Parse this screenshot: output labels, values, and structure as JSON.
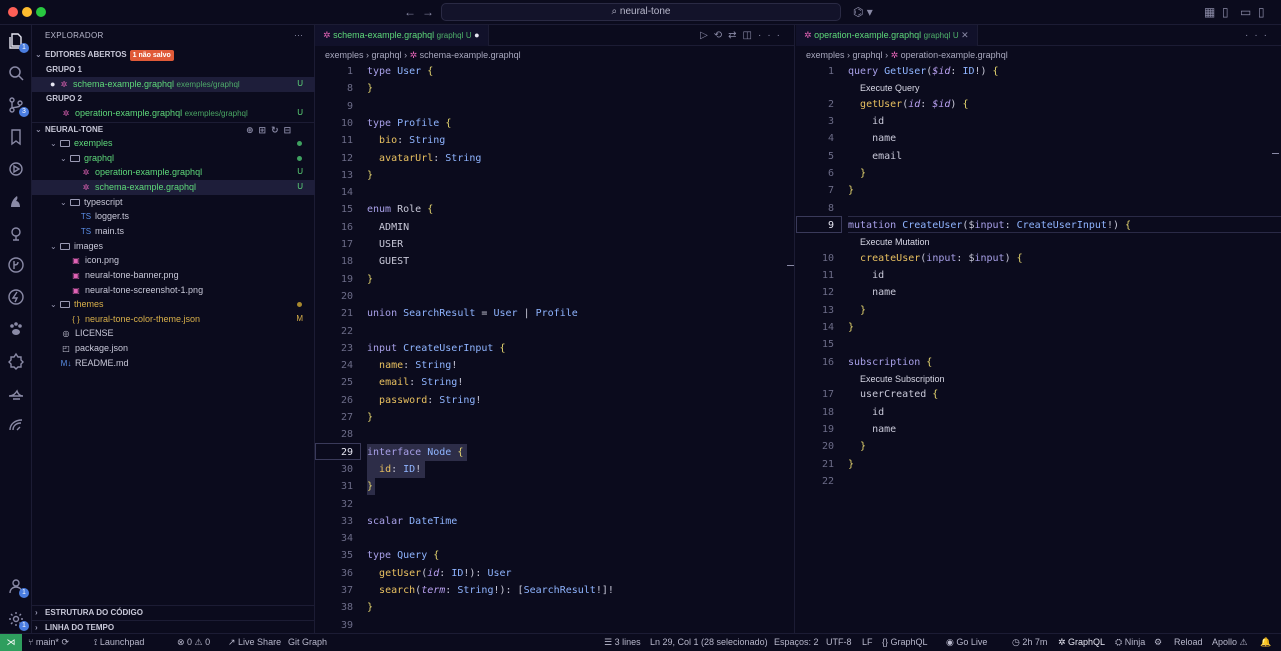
{
  "window": {
    "search_text": "neural-tone",
    "search_icon": "search-icon"
  },
  "explorer": {
    "title": "EXPLORADOR",
    "open_editors": {
      "label": "EDITORES ABERTOS",
      "badge": "1 não salvo"
    },
    "group1": {
      "label": "GRUPO 1",
      "file": "schema-example.graphql",
      "path": "exemples/graphql",
      "status": "U"
    },
    "group2": {
      "label": "GRUPO 2",
      "file": "operation-example.graphql",
      "path": "exemples/graphql",
      "status": "U"
    },
    "project": "NEURAL-TONE",
    "tree": [
      {
        "name": "exemples",
        "indent": 1,
        "kind": "folder",
        "status": "dot-green"
      },
      {
        "name": "graphql",
        "indent": 2,
        "kind": "folder",
        "status": "dot-green"
      },
      {
        "name": "operation-example.graphql",
        "indent": 3,
        "kind": "graphql",
        "status": "U"
      },
      {
        "name": "schema-example.graphql",
        "indent": 3,
        "kind": "graphql",
        "status": "U",
        "selected": true
      },
      {
        "name": "typescript",
        "indent": 2,
        "kind": "folder",
        "status": ""
      },
      {
        "name": "logger.ts",
        "indent": 3,
        "kind": "ts",
        "status": ""
      },
      {
        "name": "main.ts",
        "indent": 3,
        "kind": "ts",
        "status": ""
      },
      {
        "name": "images",
        "indent": 1,
        "kind": "folder",
        "status": ""
      },
      {
        "name": "icon.png",
        "indent": 2,
        "kind": "img",
        "status": ""
      },
      {
        "name": "neural-tone-banner.png",
        "indent": 2,
        "kind": "img",
        "status": ""
      },
      {
        "name": "neural-tone-screenshot-1.png",
        "indent": 2,
        "kind": "img",
        "status": ""
      },
      {
        "name": "themes",
        "indent": 1,
        "kind": "folder",
        "status": "dot-yellow"
      },
      {
        "name": "neural-tone-color-theme.json",
        "indent": 2,
        "kind": "json",
        "status": "M"
      },
      {
        "name": "LICENSE",
        "indent": 1,
        "kind": "license",
        "status": ""
      },
      {
        "name": "package.json",
        "indent": 1,
        "kind": "npm",
        "status": ""
      },
      {
        "name": "README.md",
        "indent": 1,
        "kind": "md",
        "status": ""
      }
    ],
    "outline": "ESTRUTURA DO CÓDIGO",
    "timeline": "LINHA DO TEMPO"
  },
  "left_editor": {
    "tab": {
      "file": "schema-example.graphql",
      "path": "graphql",
      "status": "U"
    },
    "crumbs": {
      "a": "exemples",
      "b": "graphql",
      "c": "schema-example.graphql"
    },
    "lines": [
      {
        "n": "1",
        "t": "type User {"
      },
      {
        "n": "8",
        "t": "}"
      },
      {
        "n": "9",
        "t": ""
      },
      {
        "n": "10",
        "t": "type Profile {"
      },
      {
        "n": "11",
        "t": "  bio: String"
      },
      {
        "n": "12",
        "t": "  avatarUrl: String"
      },
      {
        "n": "13",
        "t": "}"
      },
      {
        "n": "14",
        "t": ""
      },
      {
        "n": "15",
        "t": "enum Role {"
      },
      {
        "n": "16",
        "t": "  ADMIN"
      },
      {
        "n": "17",
        "t": "  USER"
      },
      {
        "n": "18",
        "t": "  GUEST"
      },
      {
        "n": "19",
        "t": "}"
      },
      {
        "n": "20",
        "t": ""
      },
      {
        "n": "21",
        "t": "union SearchResult = User | Profile"
      },
      {
        "n": "22",
        "t": ""
      },
      {
        "n": "23",
        "t": "input CreateUserInput {"
      },
      {
        "n": "24",
        "t": "  name: String!"
      },
      {
        "n": "25",
        "t": "  email: String!"
      },
      {
        "n": "26",
        "t": "  password: String!"
      },
      {
        "n": "27",
        "t": "}"
      },
      {
        "n": "28",
        "t": ""
      },
      {
        "n": "29",
        "t": "interface Node {"
      },
      {
        "n": "30",
        "t": "  id: ID!"
      },
      {
        "n": "31",
        "t": "}"
      },
      {
        "n": "32",
        "t": ""
      },
      {
        "n": "33",
        "t": "scalar DateTime"
      },
      {
        "n": "34",
        "t": ""
      },
      {
        "n": "35",
        "t": "type Query {"
      },
      {
        "n": "36",
        "t": "  getUser(id: ID!): User"
      },
      {
        "n": "37",
        "t": "  search(term: String!): [SearchResult!]!"
      },
      {
        "n": "38",
        "t": "}"
      },
      {
        "n": "39",
        "t": ""
      }
    ]
  },
  "right_editor": {
    "tab": {
      "file": "operation-example.graphql",
      "path": "graphql",
      "status": "U"
    },
    "crumbs": {
      "a": "exemples",
      "b": "graphql",
      "c": "operation-example.graphql"
    },
    "lens": {
      "query": "Execute Query",
      "mutation": "Execute Mutation",
      "subscription": "Execute Subscription"
    },
    "lines": [
      {
        "n": "1",
        "t": "query GetUser($id: ID!) {"
      },
      {
        "n": "2",
        "t": "  getUser(id: $id) {"
      },
      {
        "n": "3",
        "t": "    id"
      },
      {
        "n": "4",
        "t": "    name"
      },
      {
        "n": "5",
        "t": "    email"
      },
      {
        "n": "6",
        "t": "  }"
      },
      {
        "n": "7",
        "t": "}"
      },
      {
        "n": "8",
        "t": ""
      },
      {
        "n": "9",
        "t": "mutation CreateUser($input: CreateUserInput!) {"
      },
      {
        "n": "10",
        "t": "  createUser(input: $input) {"
      },
      {
        "n": "11",
        "t": "    id"
      },
      {
        "n": "12",
        "t": "    name"
      },
      {
        "n": "13",
        "t": "  }"
      },
      {
        "n": "14",
        "t": "}"
      },
      {
        "n": "15",
        "t": ""
      },
      {
        "n": "16",
        "t": "subscription {"
      },
      {
        "n": "17",
        "t": "  userCreated {"
      },
      {
        "n": "18",
        "t": "    id"
      },
      {
        "n": "19",
        "t": "    name"
      },
      {
        "n": "20",
        "t": "  }"
      },
      {
        "n": "21",
        "t": "}"
      },
      {
        "n": "22",
        "t": ""
      }
    ]
  },
  "statusbar": {
    "branch": "main*",
    "launchpad": "Launchpad",
    "problems": "0 ⚠ 0",
    "liveshare": "Live Share",
    "gitgraph": "Git Graph",
    "lines": "3 lines",
    "position": "Ln 29, Col 1 (28 selecionado)",
    "spaces": "Espaços: 2",
    "encoding": "UTF-8",
    "eol": "LF",
    "language": "GraphQL",
    "golive": "Go Live",
    "time": "2h 7m",
    "graphql": "GraphQL",
    "ninja": "Ninja",
    "reload": "Reload",
    "apollo": "Apollo"
  },
  "colors": {
    "accent_green": "#5ed97a",
    "badge_orange": "#e05a38",
    "remote_green": "#2e9e5e"
  }
}
